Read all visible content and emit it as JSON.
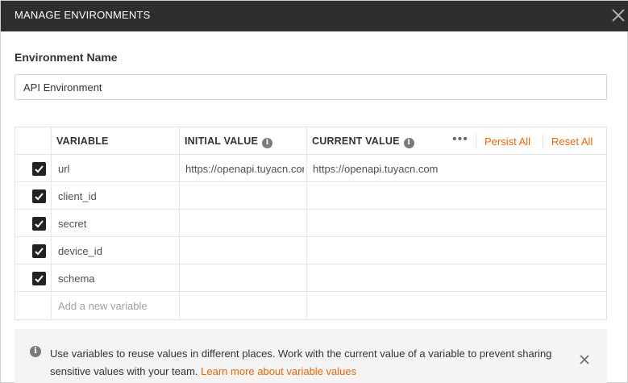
{
  "dialog": {
    "title": "MANAGE ENVIRONMENTS",
    "close_icon": "close-icon"
  },
  "environment": {
    "label": "Environment Name",
    "name_value": "API Environment"
  },
  "table": {
    "headers": {
      "variable": "VARIABLE",
      "initial_value": "INITIAL VALUE",
      "current_value": "CURRENT VALUE"
    },
    "info_icon": "info-icon",
    "more_icon": "more-options-icon",
    "more_glyph": "•••",
    "info_glyph": "i",
    "persist_all": "Persist All",
    "reset_all": "Reset All",
    "rows": [
      {
        "checked": true,
        "variable": "url",
        "initial": "https://openapi.tuyacn.com",
        "current": "https://openapi.tuyacn.com"
      },
      {
        "checked": true,
        "variable": "client_id",
        "initial": "",
        "current": ""
      },
      {
        "checked": true,
        "variable": "secret",
        "initial": "",
        "current": ""
      },
      {
        "checked": true,
        "variable": "device_id",
        "initial": "",
        "current": ""
      },
      {
        "checked": true,
        "variable": "schema",
        "initial": "",
        "current": ""
      }
    ],
    "new_variable_placeholder": "Add a new variable"
  },
  "info_bar": {
    "message": "Use variables to reuse values in different places. Work with the current value of a variable to prevent sharing sensitive values with your team.",
    "link": "Learn more about variable values",
    "dismiss_icon": "close-icon"
  },
  "colors": {
    "titlebar": "#2e2e2e",
    "accent": "#e8660b",
    "checkbox": "#222222"
  }
}
